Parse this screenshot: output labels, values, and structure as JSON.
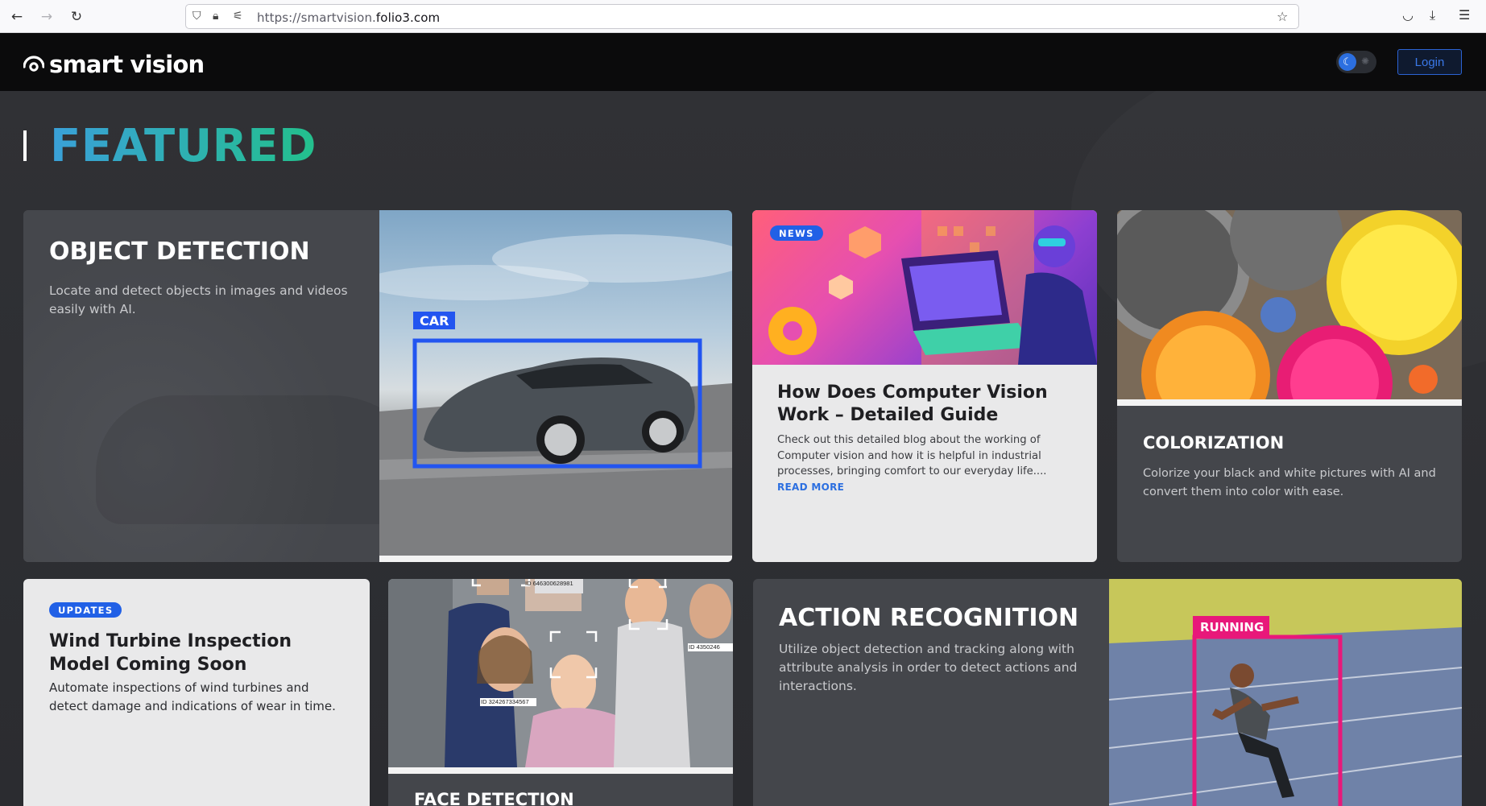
{
  "browser": {
    "url_prefix": "https://smartvision.",
    "url_host": "folio3.com"
  },
  "header": {
    "logo_text": "smart vision",
    "login_label": "Login"
  },
  "featured": {
    "title": "FEATURED"
  },
  "cards": {
    "object_detection": {
      "title": "OBJECT DETECTION",
      "description": "Locate and detect objects in images and videos easily with AI.",
      "box_label": "CAR"
    },
    "blog": {
      "badge": "NEWS",
      "title": "How Does Computer Vision Work – Detailed Guide",
      "description": "Check out this detailed blog about the working of Computer vision and how it is helpful in industrial processes, bringing comfort to our everyday life.... ",
      "read_more": "READ MORE"
    },
    "colorization": {
      "title": "COLORIZATION",
      "description": "Colorize your black and white pictures with AI and convert them into color with ease."
    },
    "updates": {
      "badge": "UPDATES",
      "title": "Wind Turbine Inspection Model Coming Soon",
      "description": "Automate inspections of wind turbines and detect damage and indications of wear in time."
    },
    "face_detection": {
      "title": "FACE DETECTION",
      "id_labels": [
        "ID 646300628981",
        "ID 324267334567",
        "ID 4350246"
      ]
    },
    "action_recognition": {
      "title": "ACTION RECOGNITION",
      "description": "Utilize object detection and tracking along with attribute analysis in order to detect actions and interactions.",
      "box_label": "RUNNING"
    }
  },
  "colors": {
    "header_bg": "#0b0b0c",
    "page_bg": "#2c2d31",
    "accent_blue": "#2160e6",
    "featured_gradient_start": "#3aa0d9",
    "featured_gradient_end": "#23c08c",
    "detection_box": "#2255f0",
    "running_box": "#e8187a"
  },
  "icons": {
    "back": "arrow-left-icon",
    "forward": "arrow-right-icon",
    "reload": "reload-icon",
    "shield": "shield-icon",
    "lock": "lock-icon",
    "permissions": "permissions-icon",
    "bookmark": "star-icon",
    "pocket": "pocket-icon",
    "downloads": "download-icon",
    "menu": "hamburger-menu-icon",
    "theme_dark": "moon-icon",
    "theme_light": "sun-icon"
  }
}
